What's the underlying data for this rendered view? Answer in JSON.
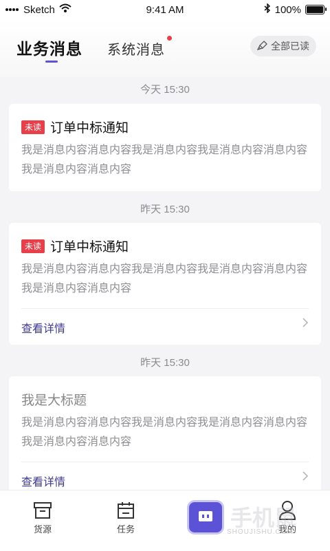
{
  "status_bar": {
    "carrier": "Sketch",
    "time": "9:41 AM",
    "battery": "100%"
  },
  "header": {
    "tab_business": "业务消息",
    "tab_system": "系统消息",
    "mark_all_read": "全部已读"
  },
  "messages": [
    {
      "date": "今天 15:30",
      "badge": "未读",
      "title": "订单中标通知",
      "body": "我是消息内容消息内容我是消息内容我是消息内容消息内容我是消息内容消息内容",
      "detail": ""
    },
    {
      "date": "昨天 15:30",
      "badge": "未读",
      "title": "订单中标通知",
      "body": "我是消息内容消息内容我是消息内容我是消息内容消息内容我是消息内容消息内容",
      "detail": "查看详情"
    },
    {
      "date": "昨天 15:30",
      "badge": "",
      "title": "我是大标题",
      "body": "我是消息内容消息内容我是消息内容我是消息内容消息内容我是消息内容消息内容",
      "detail": "查看详情"
    }
  ],
  "tabbar": {
    "source": "货源",
    "task": "任务",
    "mine": "我的"
  },
  "watermark": {
    "main": "手机鼠",
    "sub": "SHOUJISHU.COM"
  },
  "colors": {
    "accent": "#5b52d6",
    "badge_red": "#e8404a",
    "link": "#3d3a8e"
  }
}
